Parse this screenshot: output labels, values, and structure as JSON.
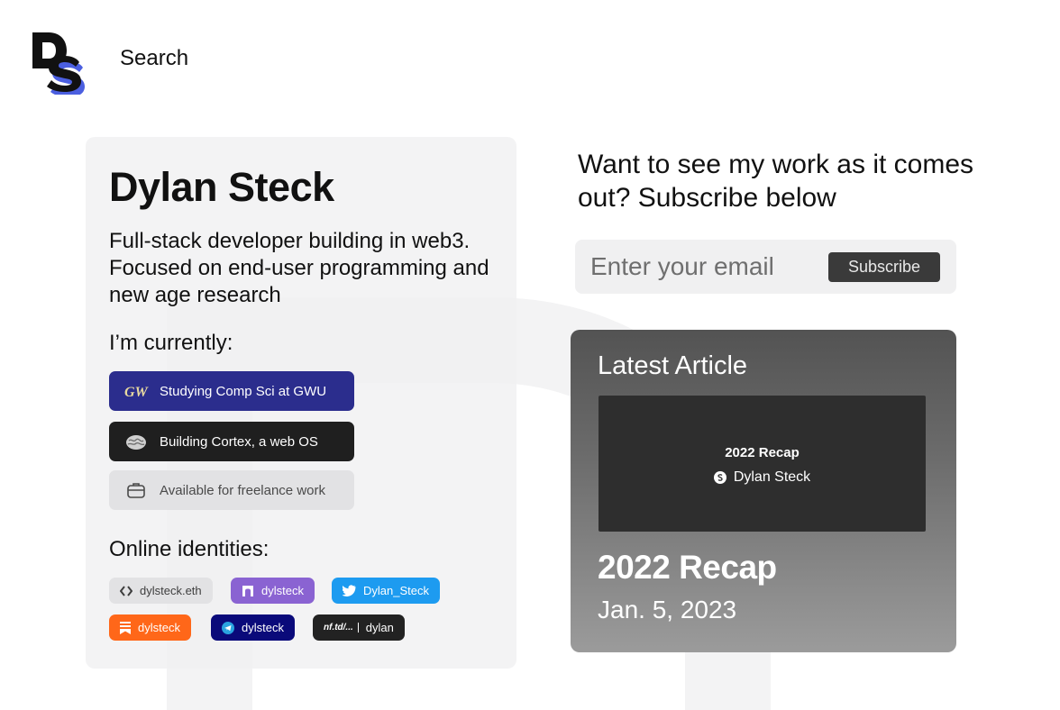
{
  "header": {
    "logo_text": "DS",
    "search_label": "Search"
  },
  "profile": {
    "name": "Dylan Steck",
    "bio": "Full-stack developer building in web3. Focused on end-user programming and new age research",
    "currently_heading": "I’m currently:",
    "currently": [
      {
        "label": "Studying Comp Sci at GWU",
        "icon": "gwu-logo-icon",
        "color": "#2b2d8d"
      },
      {
        "label": "Building Cortex, a web OS",
        "icon": "cortex-brain-icon",
        "color": "#1f1f1f"
      },
      {
        "label": "Available for freelance work",
        "icon": "briefcase-icon",
        "color": "#e2e2e4"
      }
    ],
    "identities_heading": "Online identities:",
    "identities": [
      {
        "label": "dylsteck.eth",
        "icon": "code-brackets-icon",
        "color": "#e2e2e4"
      },
      {
        "label": "dylsteck",
        "icon": "farcaster-arch-icon",
        "color": "#8a63d2"
      },
      {
        "label": "Dylan_Steck",
        "icon": "twitter-bird-icon",
        "color": "#1d9bf0"
      },
      {
        "label": "dylsteck",
        "icon": "substack-icon",
        "color": "#ff6719"
      },
      {
        "label": "dylsteck",
        "icon": "telegram-icon",
        "color": "#0a0a7a"
      },
      {
        "label": "dylan",
        "icon": "nftd-logo-icon",
        "icon_text": "nf.td/...",
        "color": "#222222"
      }
    ]
  },
  "subscribe": {
    "heading": "Want to see my work as it comes out? Subscribe below",
    "email_placeholder": "Enter your email",
    "button_label": "Subscribe"
  },
  "article": {
    "section_label": "Latest Article",
    "thumbnail_title": "2022 Recap",
    "thumbnail_author": "Dylan Steck",
    "title": "2022 Recap",
    "date": "Jan. 5, 2023"
  }
}
